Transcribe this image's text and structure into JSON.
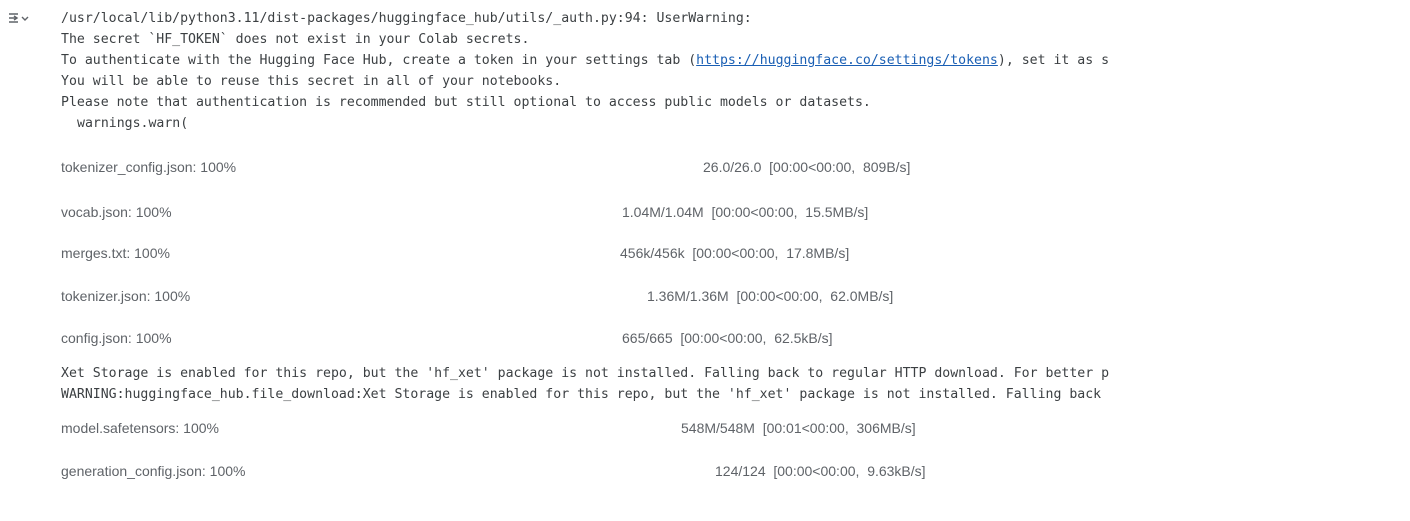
{
  "output_toggle": {
    "icon": "output-collapse-icon"
  },
  "warning": {
    "path_line": "/usr/local/lib/python3.11/dist-packages/huggingface_hub/utils/_auth.py:94: UserWarning:",
    "line2": "The secret `HF_TOKEN` does not exist in your Colab secrets.",
    "line3_prefix": "To authenticate with the Hugging Face Hub, create a token in your settings tab (",
    "line3_link": "https://huggingface.co/settings/tokens",
    "line3_suffix": "), set it as s",
    "line4": "You will be able to reuse this secret in all of your notebooks.",
    "line5": "Please note that authentication is recommended but still optional to access public models or datasets.",
    "line6": "warnings.warn("
  },
  "downloads": [
    {
      "name": "tokenizer_config.json: 100%",
      "stats": "26.0/26.0  [00:00<00:00,  809B/s]",
      "progress": 1.0
    },
    {
      "name": "vocab.json: 100%",
      "stats": "1.04M/1.04M  [00:00<00:00,  15.5MB/s]",
      "progress": 1.0
    },
    {
      "name": "merges.txt: 100%",
      "stats": "456k/456k  [00:00<00:00,  17.8MB/s]",
      "progress": 1.0
    },
    {
      "name": "tokenizer.json: 100%",
      "stats": "1.36M/1.36M  [00:00<00:00,  62.0MB/s]",
      "progress": 1.0
    },
    {
      "name": "config.json: 100%",
      "stats": "665/665  [00:00<00:00,  62.5kB/s]",
      "progress": 1.0
    }
  ],
  "xet": {
    "line1": "Xet Storage is enabled for this repo, but the 'hf_xet' package is not installed. Falling back to regular HTTP download. For better p",
    "line2": "WARNING:huggingface_hub.file_download:Xet Storage is enabled for this repo, but the 'hf_xet' package is not installed. Falling back"
  },
  "downloads2": [
    {
      "name": "model.safetensors: 100%",
      "stats": "548M/548M  [00:01<00:00,  306MB/s]",
      "progress": 1.0
    },
    {
      "name": "generation_config.json: 100%",
      "stats": "124/124  [00:00<00:00,  9.63kB/s]",
      "progress": 1.0
    }
  ]
}
